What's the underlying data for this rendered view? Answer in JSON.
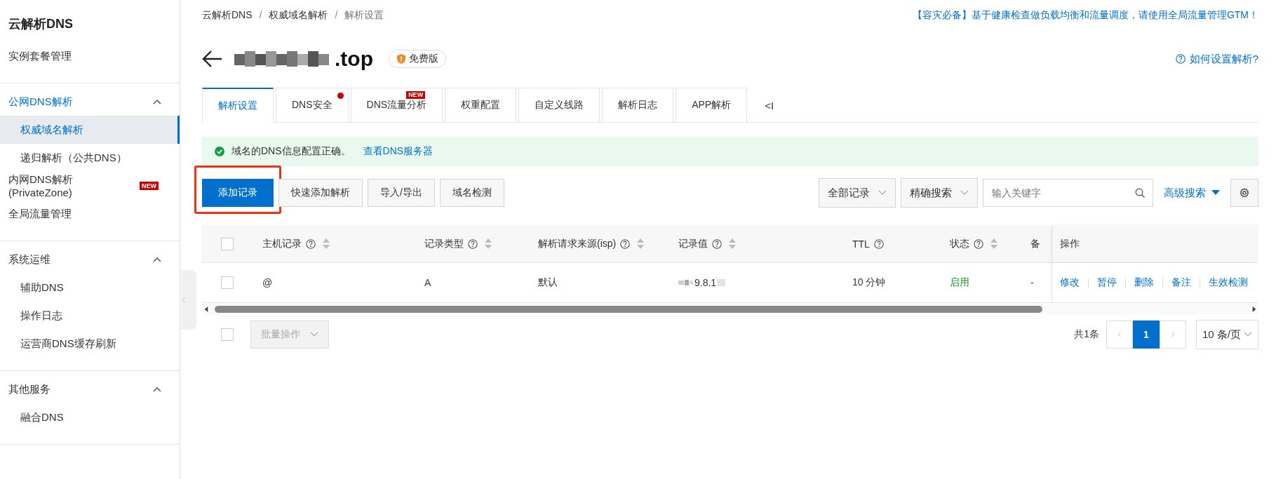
{
  "sidebar": {
    "title": "云解析DNS",
    "groups": [
      {
        "label": "实例套餐管理",
        "kind": "link"
      },
      {
        "label": "公网DNS解析",
        "kind": "group",
        "expanded": true,
        "active": true,
        "items": [
          {
            "label": "权威域名解析",
            "selected": true
          },
          {
            "label": "递归解析（公共DNS）",
            "selected": false
          }
        ]
      },
      {
        "label": "内网DNS解析 (PrivateZone)",
        "kind": "link",
        "badge": "NEW"
      },
      {
        "label": "全局流量管理",
        "kind": "link"
      },
      {
        "label": "系统运维",
        "kind": "group",
        "expanded": true,
        "active": false,
        "items": [
          {
            "label": "辅助DNS",
            "selected": false
          },
          {
            "label": "操作日志",
            "selected": false
          },
          {
            "label": "运营商DNS缓存刷新",
            "selected": false
          }
        ]
      },
      {
        "label": "其他服务",
        "kind": "group",
        "expanded": true,
        "active": false,
        "items": [
          {
            "label": "融合DNS",
            "selected": false
          }
        ]
      }
    ]
  },
  "breadcrumb": {
    "separator": "/",
    "items": [
      "云解析DNS",
      "权威域名解析",
      "解析设置"
    ]
  },
  "promo": "【容灾必备】基于健康检查做负载均衡和流量调度，请使用全局流量管理GTM！",
  "title": {
    "domain": ".top",
    "edition": "免费版"
  },
  "help_link": "如何设置解析?",
  "tabs": [
    {
      "label": "解析设置",
      "selected": true,
      "dot": false
    },
    {
      "label": "DNS安全",
      "selected": false,
      "dot": true
    },
    {
      "label": "DNS流量分析",
      "selected": false,
      "dot": false,
      "badge": "NEW"
    },
    {
      "label": "权重配置",
      "selected": false,
      "dot": false
    },
    {
      "label": "自定义线路",
      "selected": false,
      "dot": false
    },
    {
      "label": "解析日志",
      "selected": false,
      "dot": false
    },
    {
      "label": "APP解析",
      "selected": false,
      "dot": false
    }
  ],
  "tabs_more": "<I",
  "alert": {
    "message": "域名的DNS信息配置正确。",
    "link": "查看DNS服务器"
  },
  "toolbar": {
    "buttons": [
      {
        "label": "添加记录",
        "kind": "primary",
        "highlighted": true
      },
      {
        "label": "快速添加解析",
        "kind": "default",
        "highlighted": false
      },
      {
        "label": "导入/导出",
        "kind": "default",
        "highlighted": false
      },
      {
        "label": "域名检测",
        "kind": "default",
        "highlighted": false
      }
    ],
    "filter": "全部记录",
    "search_mode": "精确搜索",
    "search": {
      "placeholder": "输入关键字"
    },
    "advanced": "高级搜索"
  },
  "table": {
    "header_checked": false,
    "columns": [
      {
        "label": "主机记录",
        "help": true,
        "sortable": true
      },
      {
        "label": "记录类型",
        "help": true,
        "sortable": true
      },
      {
        "label": "解析请求来源(isp)",
        "help": true,
        "sortable": true
      },
      {
        "label": "记录值",
        "help": true,
        "sortable": true
      },
      {
        "label": "TTL",
        "help": true,
        "sortable": false
      },
      {
        "label": "状态",
        "help": true,
        "sortable": true
      },
      {
        "label": "备",
        "help": false,
        "sortable": false
      },
      {
        "label": "操作",
        "help": false,
        "sortable": false
      }
    ],
    "rows": [
      {
        "checked": false,
        "host": "@",
        "type": "A",
        "isp": "默认",
        "value": "9.8.1",
        "ttl": "10 分钟",
        "status": "启用",
        "enabled": true,
        "remark": "-",
        "actions": [
          "修改",
          "暂停",
          "删除",
          "备注",
          "生效检测"
        ]
      }
    ]
  },
  "footer": {
    "checked": false,
    "batch": "批量操作",
    "total": "共1条",
    "pages": [
      {
        "label": "1",
        "selected": true
      }
    ],
    "page_size": "10 条/页"
  }
}
